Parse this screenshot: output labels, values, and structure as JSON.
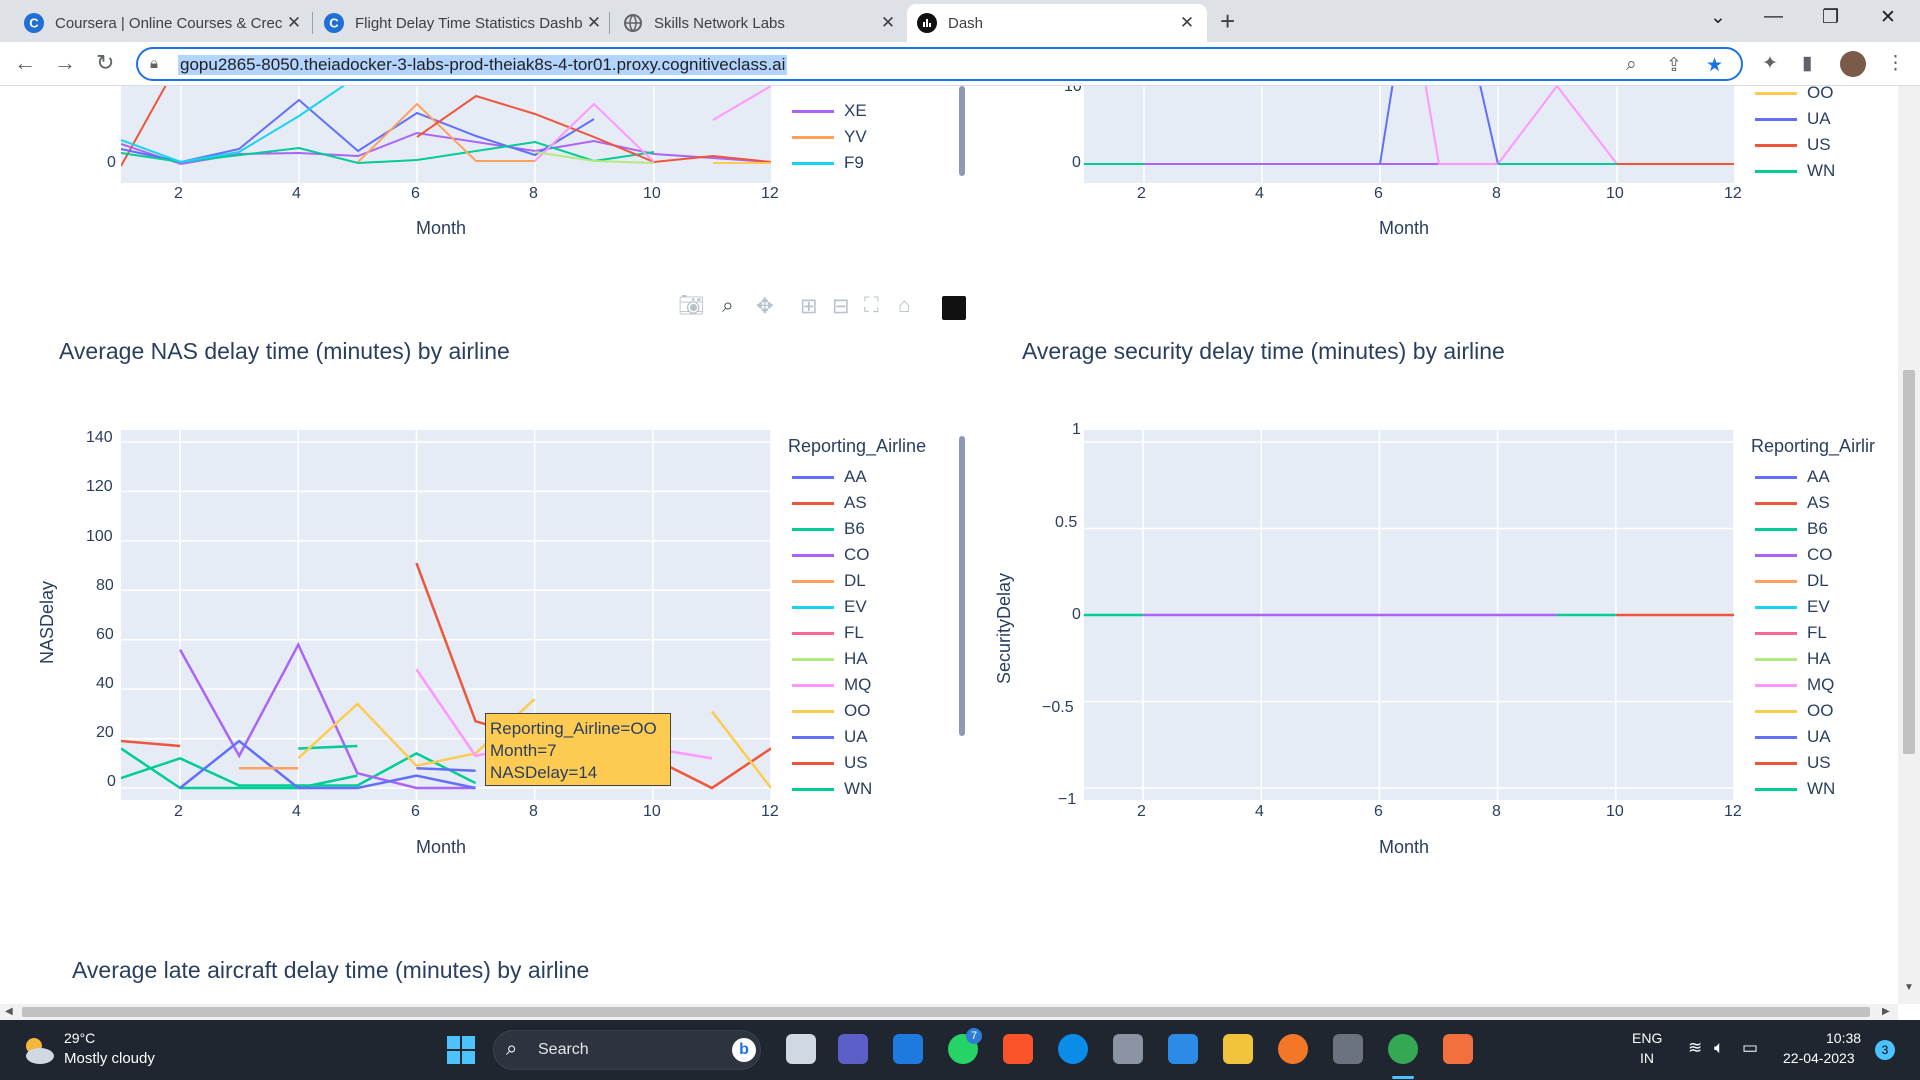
{
  "browser": {
    "tabs": [
      {
        "title": "Coursera | Online Courses & Crec",
        "icon": "coursera-icon"
      },
      {
        "title": "Flight Delay Time Statistics Dashb",
        "icon": "coursera-icon"
      },
      {
        "title": "Skills Network Labs",
        "icon": "globe-icon"
      },
      {
        "title": "Dash",
        "icon": "dash-icon"
      }
    ],
    "url": "gopu2865-8050.theiadocker-3-labs-prod-theiak8s-4-tor01.proxy.cognitiveclass.ai"
  },
  "top_charts": {
    "xlabel": "Month",
    "xticks": [
      "2",
      "4",
      "6",
      "8",
      "10",
      "12"
    ],
    "left_yticks": [
      "0"
    ],
    "right_yticks": [
      "10",
      "0"
    ],
    "left_legend": [
      {
        "name": "XE",
        "color": "#ab63fa"
      },
      {
        "name": "YV",
        "color": "#ffa15a"
      },
      {
        "name": "F9",
        "color": "#19d3f3"
      }
    ],
    "right_legend": [
      {
        "name": "OO",
        "color": "#fecb52"
      },
      {
        "name": "UA",
        "color": "#636efa"
      },
      {
        "name": "US",
        "color": "#ef553b"
      },
      {
        "name": "WN",
        "color": "#00cc96"
      }
    ]
  },
  "nas_chart": {
    "title": "Average NAS delay time (minutes) by airline",
    "ylabel": "NASDelay",
    "xlabel": "Month",
    "yticks": [
      "140",
      "120",
      "100",
      "80",
      "60",
      "40",
      "20",
      "0"
    ],
    "xticks": [
      "2",
      "4",
      "6",
      "8",
      "10",
      "12"
    ],
    "legend_title": "Reporting_Airline",
    "hover": {
      "l1": "Reporting_Airline=OO",
      "l2": "Month=7",
      "l3": "NASDelay=14"
    }
  },
  "security_chart": {
    "title": "Average security delay time (minutes) by airline",
    "ylabel": "SecurityDelay",
    "xlabel": "Month",
    "yticks": [
      "1",
      "0.5",
      "0",
      "−0.5",
      "−1"
    ],
    "xticks": [
      "2",
      "4",
      "6",
      "8",
      "10",
      "12"
    ],
    "legend_title": "Reporting_Airlir"
  },
  "late_chart": {
    "title": "Average late aircraft delay time (minutes) by airline"
  },
  "legend": [
    {
      "name": "AA",
      "color": "#636efa"
    },
    {
      "name": "AS",
      "color": "#ef553b"
    },
    {
      "name": "B6",
      "color": "#00cc96"
    },
    {
      "name": "CO",
      "color": "#ab63fa"
    },
    {
      "name": "DL",
      "color": "#ffa15a"
    },
    {
      "name": "EV",
      "color": "#19d3f3"
    },
    {
      "name": "FL",
      "color": "#ff6692"
    },
    {
      "name": "HA",
      "color": "#b6e880"
    },
    {
      "name": "MQ",
      "color": "#ff97ff"
    },
    {
      "name": "OO",
      "color": "#fecb52"
    },
    {
      "name": "UA",
      "color": "#636efa"
    },
    {
      "name": "US",
      "color": "#ef553b"
    },
    {
      "name": "WN",
      "color": "#00cc96"
    }
  ],
  "chart_data": [
    {
      "type": "line",
      "title": "Average NAS delay time (minutes) by airline",
      "xlabel": "Month",
      "ylabel": "NASDelay",
      "xlim": [
        1,
        12
      ],
      "ylim": [
        0,
        140
      ],
      "series": [
        {
          "name": "AS",
          "values": [
            [
              1,
              19
            ],
            [
              2,
              17
            ]
          ]
        },
        {
          "name": "B6",
          "values": [
            [
              1,
              16
            ],
            [
              2,
              0
            ],
            [
              3,
              0
            ],
            [
              4,
              0
            ],
            [
              5,
              5
            ]
          ]
        },
        {
          "name": "WN",
          "values": [
            [
              1,
              4
            ],
            [
              2,
              12
            ],
            [
              3,
              1
            ],
            [
              4,
              1
            ],
            [
              5,
              1
            ],
            [
              6,
              14
            ],
            [
              7,
              2
            ]
          ]
        },
        {
          "name": "CO",
          "values": [
            [
              2,
              56
            ],
            [
              3,
              13
            ],
            [
              4,
              58
            ],
            [
              5,
              6
            ],
            [
              6,
              0
            ],
            [
              7,
              0
            ]
          ]
        },
        {
          "name": "UA",
          "values": [
            [
              2,
              0
            ],
            [
              3,
              19
            ],
            [
              4,
              0
            ],
            [
              5,
              0
            ],
            [
              6,
              5
            ],
            [
              7,
              0
            ]
          ]
        },
        {
          "name": "DL",
          "values": [
            [
              3,
              8
            ],
            [
              4,
              8
            ]
          ]
        },
        {
          "name": "WN",
          "values": [
            [
              4,
              16
            ],
            [
              5,
              17
            ]
          ]
        },
        {
          "name": "OO",
          "values": [
            [
              4,
              12
            ],
            [
              5,
              34
            ],
            [
              6,
              9
            ],
            [
              7,
              14
            ],
            [
              8,
              36
            ]
          ]
        },
        {
          "name": "US",
          "values": [
            [
              6,
              91
            ],
            [
              7,
              27
            ],
            [
              8,
              20
            ],
            [
              9,
              15
            ],
            [
              10,
              12
            ],
            [
              11,
              0
            ],
            [
              12,
              16
            ]
          ]
        },
        {
          "name": "MQ",
          "values": [
            [
              6,
              48
            ],
            [
              7,
              13
            ],
            [
              8,
              18
            ],
            [
              10,
              16
            ],
            [
              11,
              12
            ]
          ]
        },
        {
          "name": "OO",
          "values": [
            [
              11,
              31
            ],
            [
              12,
              0
            ]
          ]
        },
        {
          "name": "UA",
          "values": [
            [
              6,
              8
            ],
            [
              7,
              7
            ]
          ]
        }
      ]
    },
    {
      "type": "line",
      "title": "Average security delay time (minutes) by airline",
      "xlabel": "Month",
      "ylabel": "SecurityDelay",
      "xlim": [
        1,
        12
      ],
      "ylim": [
        -1,
        1
      ],
      "series": [
        {
          "name": "WN",
          "values": [
            [
              1,
              0
            ],
            [
              2,
              0
            ]
          ]
        },
        {
          "name": "CO",
          "values": [
            [
              2,
              0
            ],
            [
              9,
              0
            ]
          ]
        },
        {
          "name": "WN",
          "values": [
            [
              9,
              0
            ],
            [
              10,
              0
            ]
          ]
        },
        {
          "name": "US",
          "values": [
            [
              10,
              0
            ],
            [
              12,
              0
            ]
          ]
        }
      ]
    }
  ],
  "taskbar": {
    "temp": "29°C",
    "weather": "Mostly cloudy",
    "search": "Search",
    "lang1": "ENG",
    "lang2": "IN",
    "time": "10:38",
    "date": "22-04-2023",
    "notif": "3",
    "badge": "7"
  }
}
